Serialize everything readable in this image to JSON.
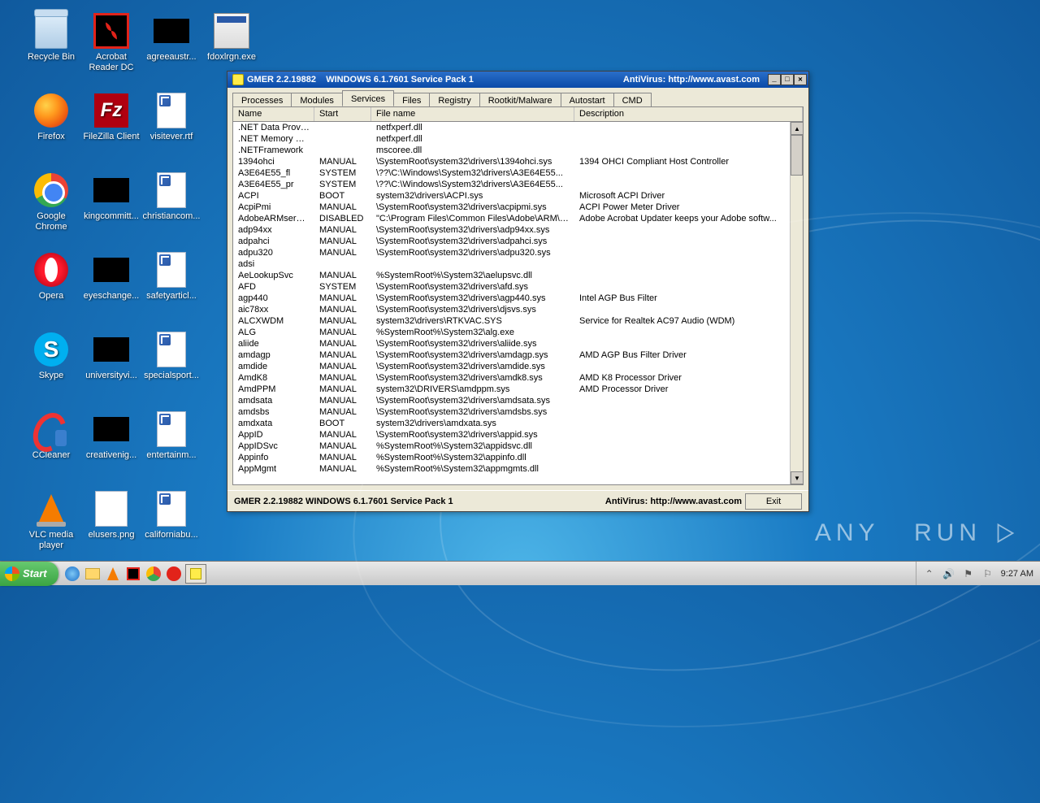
{
  "desktop_icons": [
    {
      "label": "Recycle Bin",
      "t": "bin"
    },
    {
      "label": "Acrobat Reader DC",
      "t": "acrobat"
    },
    {
      "label": "agreeaustr...",
      "t": "foldbk"
    },
    {
      "label": "fdoxlrgn.exe",
      "t": "gmex"
    },
    {
      "label": "Firefox",
      "t": "ff"
    },
    {
      "label": "FileZilla Client",
      "t": "fz"
    },
    {
      "label": "visitever.rtf",
      "t": "doc"
    },
    {
      "label": "",
      "t": "blank"
    },
    {
      "label": "Google Chrome",
      "t": "chrome"
    },
    {
      "label": "kingcommitt...",
      "t": "foldbk"
    },
    {
      "label": "christiancom...",
      "t": "doc"
    },
    {
      "label": "",
      "t": "blank"
    },
    {
      "label": "Opera",
      "t": "opera"
    },
    {
      "label": "eyeschange...",
      "t": "foldbk"
    },
    {
      "label": "safetyarticl...",
      "t": "doc"
    },
    {
      "label": "",
      "t": "blank"
    },
    {
      "label": "Skype",
      "t": "skype"
    },
    {
      "label": "universityvi...",
      "t": "foldbk"
    },
    {
      "label": "specialsport...",
      "t": "doc"
    },
    {
      "label": "",
      "t": "blank"
    },
    {
      "label": "CCleaner",
      "t": "cc"
    },
    {
      "label": "creativenig...",
      "t": "foldbk"
    },
    {
      "label": "entertainm...",
      "t": "doc"
    },
    {
      "label": "",
      "t": "blank"
    },
    {
      "label": "VLC media player",
      "t": "vlc"
    },
    {
      "label": "elusers.png",
      "t": "png"
    },
    {
      "label": "californiabu...",
      "t": "doc"
    }
  ],
  "window": {
    "title_left": "GMER 2.2.19882    WINDOWS 6.1.7601 Service Pack 1",
    "title_right": "AntiVirus: http://www.avast.com",
    "tabs": [
      "Processes",
      "Modules",
      "Services",
      "Files",
      "Registry",
      "Rootkit/Malware",
      "Autostart",
      "CMD"
    ],
    "active_tab": 2,
    "columns": [
      "Name",
      "Start",
      "File name",
      "Description"
    ],
    "rows": [
      [
        ".NET Data Provid...",
        "",
        "netfxperf.dll",
        ""
      ],
      [
        ".NET Memory Ca...",
        "",
        "netfxperf.dll",
        ""
      ],
      [
        ".NETFramework",
        "",
        "mscoree.dll",
        ""
      ],
      [
        "1394ohci",
        "MANUAL",
        "\\SystemRoot\\system32\\drivers\\1394ohci.sys",
        "1394 OHCI Compliant Host Controller"
      ],
      [
        "A3E64E55_fl",
        "SYSTEM",
        "\\??\\C:\\Windows\\System32\\drivers\\A3E64E55...",
        ""
      ],
      [
        "A3E64E55_pr",
        "SYSTEM",
        "\\??\\C:\\Windows\\System32\\drivers\\A3E64E55...",
        ""
      ],
      [
        "ACPI",
        "BOOT",
        "system32\\drivers\\ACPI.sys",
        "Microsoft ACPI Driver"
      ],
      [
        "AcpiPmi",
        "MANUAL",
        "\\SystemRoot\\system32\\drivers\\acpipmi.sys",
        "ACPI Power Meter Driver"
      ],
      [
        "AdobeARMservice",
        "DISABLED",
        "\"C:\\Program Files\\Common Files\\Adobe\\ARM\\1...",
        "Adobe Acrobat Updater keeps your Adobe softw..."
      ],
      [
        "adp94xx",
        "MANUAL",
        "\\SystemRoot\\system32\\drivers\\adp94xx.sys",
        ""
      ],
      [
        "adpahci",
        "MANUAL",
        "\\SystemRoot\\system32\\drivers\\adpahci.sys",
        ""
      ],
      [
        "adpu320",
        "MANUAL",
        "\\SystemRoot\\system32\\drivers\\adpu320.sys",
        ""
      ],
      [
        "adsi",
        "",
        "",
        ""
      ],
      [
        "AeLookupSvc",
        "MANUAL",
        "%SystemRoot%\\System32\\aelupsvc.dll",
        ""
      ],
      [
        "AFD",
        "SYSTEM",
        "\\SystemRoot\\system32\\drivers\\afd.sys",
        ""
      ],
      [
        "agp440",
        "MANUAL",
        "\\SystemRoot\\system32\\drivers\\agp440.sys",
        "Intel AGP Bus Filter"
      ],
      [
        "aic78xx",
        "MANUAL",
        "\\SystemRoot\\system32\\drivers\\djsvs.sys",
        ""
      ],
      [
        "ALCXWDM",
        "MANUAL",
        "system32\\drivers\\RTKVAC.SYS",
        "Service for Realtek AC97 Audio (WDM)"
      ],
      [
        "ALG",
        "MANUAL",
        "%SystemRoot%\\System32\\alg.exe",
        ""
      ],
      [
        "aliide",
        "MANUAL",
        "\\SystemRoot\\system32\\drivers\\aliide.sys",
        ""
      ],
      [
        "amdagp",
        "MANUAL",
        "\\SystemRoot\\system32\\drivers\\amdagp.sys",
        "AMD AGP Bus Filter Driver"
      ],
      [
        "amdide",
        "MANUAL",
        "\\SystemRoot\\system32\\drivers\\amdide.sys",
        ""
      ],
      [
        "AmdK8",
        "MANUAL",
        "\\SystemRoot\\system32\\drivers\\amdk8.sys",
        "AMD K8 Processor Driver"
      ],
      [
        "AmdPPM",
        "MANUAL",
        "system32\\DRIVERS\\amdppm.sys",
        "AMD Processor Driver"
      ],
      [
        "amdsata",
        "MANUAL",
        "\\SystemRoot\\system32\\drivers\\amdsata.sys",
        ""
      ],
      [
        "amdsbs",
        "MANUAL",
        "\\SystemRoot\\system32\\drivers\\amdsbs.sys",
        ""
      ],
      [
        "amdxata",
        "BOOT",
        "system32\\drivers\\amdxata.sys",
        ""
      ],
      [
        "AppID",
        "MANUAL",
        "\\SystemRoot\\system32\\drivers\\appid.sys",
        ""
      ],
      [
        "AppIDSvc",
        "MANUAL",
        "%SystemRoot%\\System32\\appidsvc.dll",
        ""
      ],
      [
        "Appinfo",
        "MANUAL",
        "%SystemRoot%\\System32\\appinfo.dll",
        ""
      ],
      [
        "AppMgmt",
        "MANUAL",
        "%SystemRoot%\\System32\\appmgmts.dll",
        ""
      ]
    ],
    "status_left": "GMER 2.2.19882    WINDOWS 6.1.7601 Service Pack 1",
    "status_right": "AntiVirus: http://www.avast.com",
    "exit_label": "Exit"
  },
  "watermark": "ANY   RUN",
  "taskbar": {
    "start": "Start",
    "clock": "9:27 AM"
  }
}
